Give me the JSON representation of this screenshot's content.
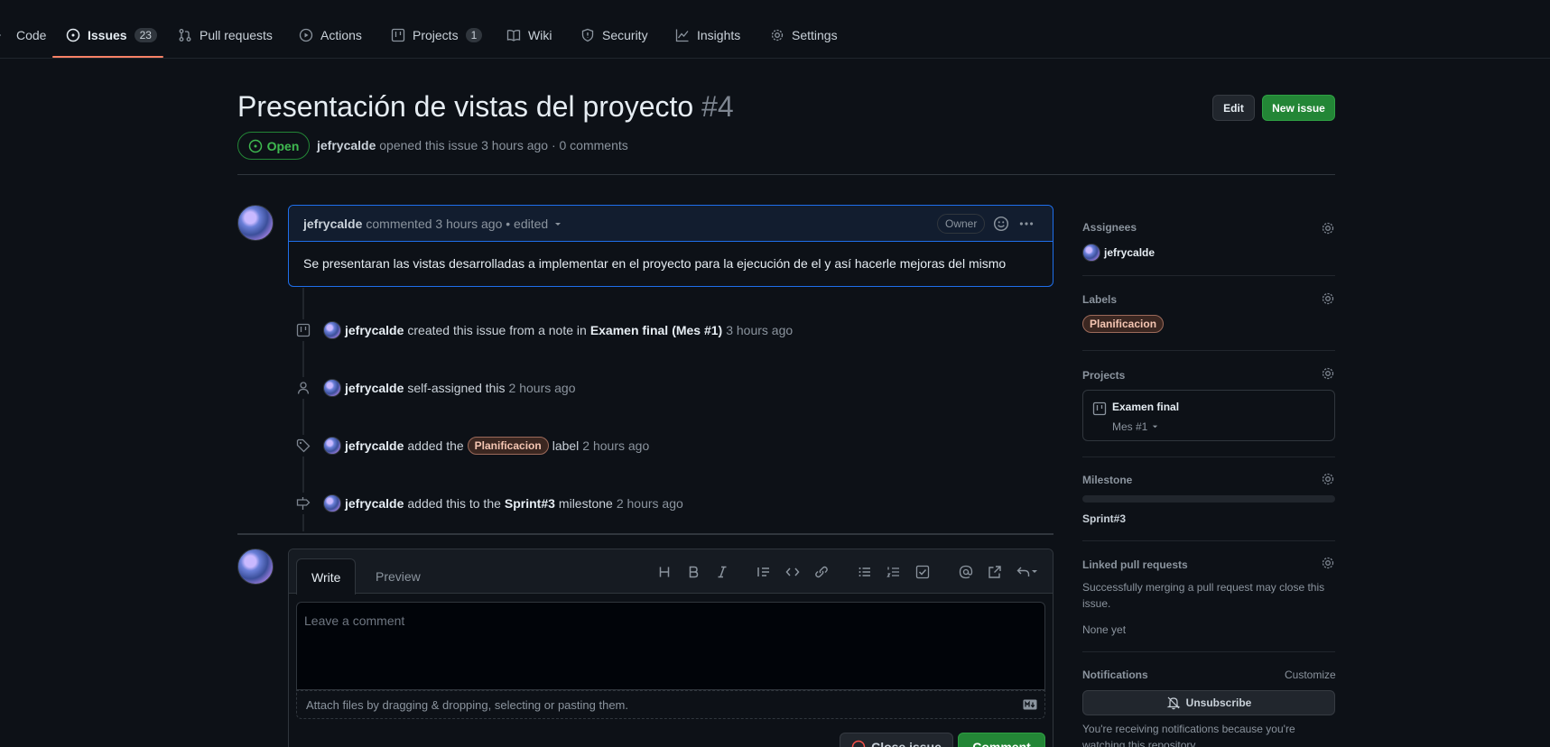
{
  "nav": {
    "tabs": [
      {
        "label": "Code"
      },
      {
        "label": "Issues",
        "count": "23"
      },
      {
        "label": "Pull requests"
      },
      {
        "label": "Actions"
      },
      {
        "label": "Projects",
        "count": "1"
      },
      {
        "label": "Wiki"
      },
      {
        "label": "Security"
      },
      {
        "label": "Insights"
      },
      {
        "label": "Settings"
      }
    ]
  },
  "issue": {
    "title": "Presentación de vistas del proyecto",
    "number": "#4",
    "state": "Open",
    "author": "jefrycalde",
    "meta": "opened this issue 3 hours ago · 0 comments",
    "edit_label": "Edit",
    "new_issue_label": "New issue"
  },
  "comment": {
    "author": "jefrycalde",
    "meta": "commented 3 hours ago • edited",
    "badge": "Owner",
    "body": "Se presentaran las vistas desarrolladas a implementar en el proyecto para la ejecución de el y así hacerle mejoras del mismo"
  },
  "events": [
    {
      "actor": "jefrycalde",
      "t1": "created this issue from a note in",
      "project": "Examen final",
      "column": "(Mes #1)",
      "time": "3 hours ago"
    },
    {
      "actor": "jefrycalde",
      "t1": "self-assigned this",
      "time": "2 hours ago"
    },
    {
      "actor": "jefrycalde",
      "t1": "added the",
      "label": "Planificacion",
      "t2": "label",
      "time": "2 hours ago"
    },
    {
      "actor": "jefrycalde",
      "t1": "added this to the",
      "milestone": "Sprint#3",
      "t2": "milestone",
      "time": "2 hours ago"
    }
  ],
  "form": {
    "tab_write": "Write",
    "tab_preview": "Preview",
    "placeholder": "Leave a comment",
    "attach": "Attach files by dragging & dropping, selecting or pasting them.",
    "close_label": "Close issue",
    "comment_label": "Comment"
  },
  "sidebar": {
    "assignees_h": "Assignees",
    "assignee": "jefrycalde",
    "labels_h": "Labels",
    "label": "Planificacion",
    "projects_h": "Projects",
    "project_name": "Examen final",
    "project_column": "Mes #1",
    "milestone_h": "Milestone",
    "milestone": "Sprint#3",
    "linked_h": "Linked pull requests",
    "linked_desc": "Successfully merging a pull request may close this issue.",
    "linked_none": "None yet",
    "notifications_h": "Notifications",
    "customize": "Customize",
    "unsubscribe": "Unsubscribe",
    "notif_desc": "You're receiving notifications because you're watching this repository."
  },
  "colors": {
    "accent_open": "#238636",
    "tab_underline": "#f78166",
    "focus_border": "#1f6feb"
  }
}
